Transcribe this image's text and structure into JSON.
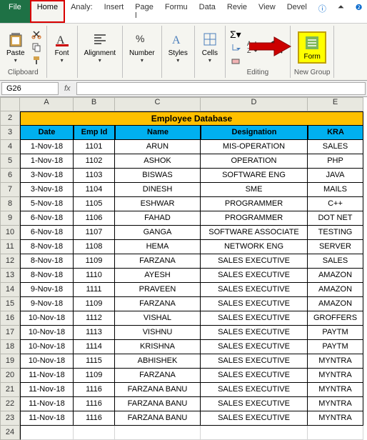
{
  "tabs": {
    "file": "File",
    "home": "Home",
    "analysis": "Analy:",
    "insert": "Insert",
    "pagelayout": "Page l",
    "formulas": "Formu",
    "data": "Data",
    "review": "Revie",
    "view": "View",
    "developer": "Devel"
  },
  "ribbon": {
    "paste": "Paste",
    "font": "Font",
    "alignment": "Alignment",
    "number": "Number",
    "styles": "Styles",
    "cells": "Cells",
    "editing": "Editing",
    "form": "Form",
    "clipboard": "Clipboard",
    "newgroup": "New Group"
  },
  "namebox": "G26",
  "fx": "fx",
  "columns": [
    "A",
    "B",
    "C",
    "D",
    "E"
  ],
  "col_widths": [
    "colA",
    "colB",
    "colC",
    "colD",
    "colE"
  ],
  "title": "Employee Database",
  "headers": [
    "Date",
    "Emp Id",
    "Name",
    "Designation",
    "KRA"
  ],
  "rows": [
    [
      "1-Nov-18",
      "1101",
      "ARUN",
      "MIS-OPERATION",
      "SALES"
    ],
    [
      "1-Nov-18",
      "1102",
      "ASHOK",
      "OPERATION",
      "PHP"
    ],
    [
      "3-Nov-18",
      "1103",
      "BISWAS",
      "SOFTWARE ENG",
      "JAVA"
    ],
    [
      "3-Nov-18",
      "1104",
      "DINESH",
      "SME",
      "MAILS"
    ],
    [
      "5-Nov-18",
      "1105",
      "ESHWAR",
      "PROGRAMMER",
      "C++"
    ],
    [
      "6-Nov-18",
      "1106",
      "FAHAD",
      "PROGRAMMER",
      "DOT NET"
    ],
    [
      "6-Nov-18",
      "1107",
      "GANGA",
      "SOFTWARE ASSOCIATE",
      "TESTING"
    ],
    [
      "8-Nov-18",
      "1108",
      "HEMA",
      "NETWORK ENG",
      "SERVER"
    ],
    [
      "8-Nov-18",
      "1109",
      "FARZANA",
      "SALES EXECUTIVE",
      "SALES"
    ],
    [
      "8-Nov-18",
      "1110",
      "AYESH",
      "SALES EXECUTIVE",
      "AMAZON"
    ],
    [
      "9-Nov-18",
      "1111",
      "PRAVEEN",
      "SALES EXECUTIVE",
      "AMAZON"
    ],
    [
      "9-Nov-18",
      "1109",
      "FARZANA",
      "SALES EXECUTIVE",
      "AMAZON"
    ],
    [
      "10-Nov-18",
      "1112",
      "VISHAL",
      "SALES EXECUTIVE",
      "GROFFERS"
    ],
    [
      "10-Nov-18",
      "1113",
      "VISHNU",
      "SALES EXECUTIVE",
      "PAYTM"
    ],
    [
      "10-Nov-18",
      "1114",
      "KRISHNA",
      "SALES EXECUTIVE",
      "PAYTM"
    ],
    [
      "10-Nov-18",
      "1115",
      "ABHISHEK",
      "SALES EXECUTIVE",
      "MYNTRA"
    ],
    [
      "11-Nov-18",
      "1109",
      "FARZANA",
      "SALES EXECUTIVE",
      "MYNTRA"
    ],
    [
      "11-Nov-18",
      "1116",
      "FARZANA BANU",
      "SALES EXECUTIVE",
      "MYNTRA"
    ],
    [
      "11-Nov-18",
      "1116",
      "FARZANA BANU",
      "SALES EXECUTIVE",
      "MYNTRA"
    ],
    [
      "11-Nov-18",
      "1116",
      "FARZANA BANU",
      "SALES EXECUTIVE",
      "MYNTRA"
    ]
  ],
  "row_start": 2,
  "empty_row": 24
}
